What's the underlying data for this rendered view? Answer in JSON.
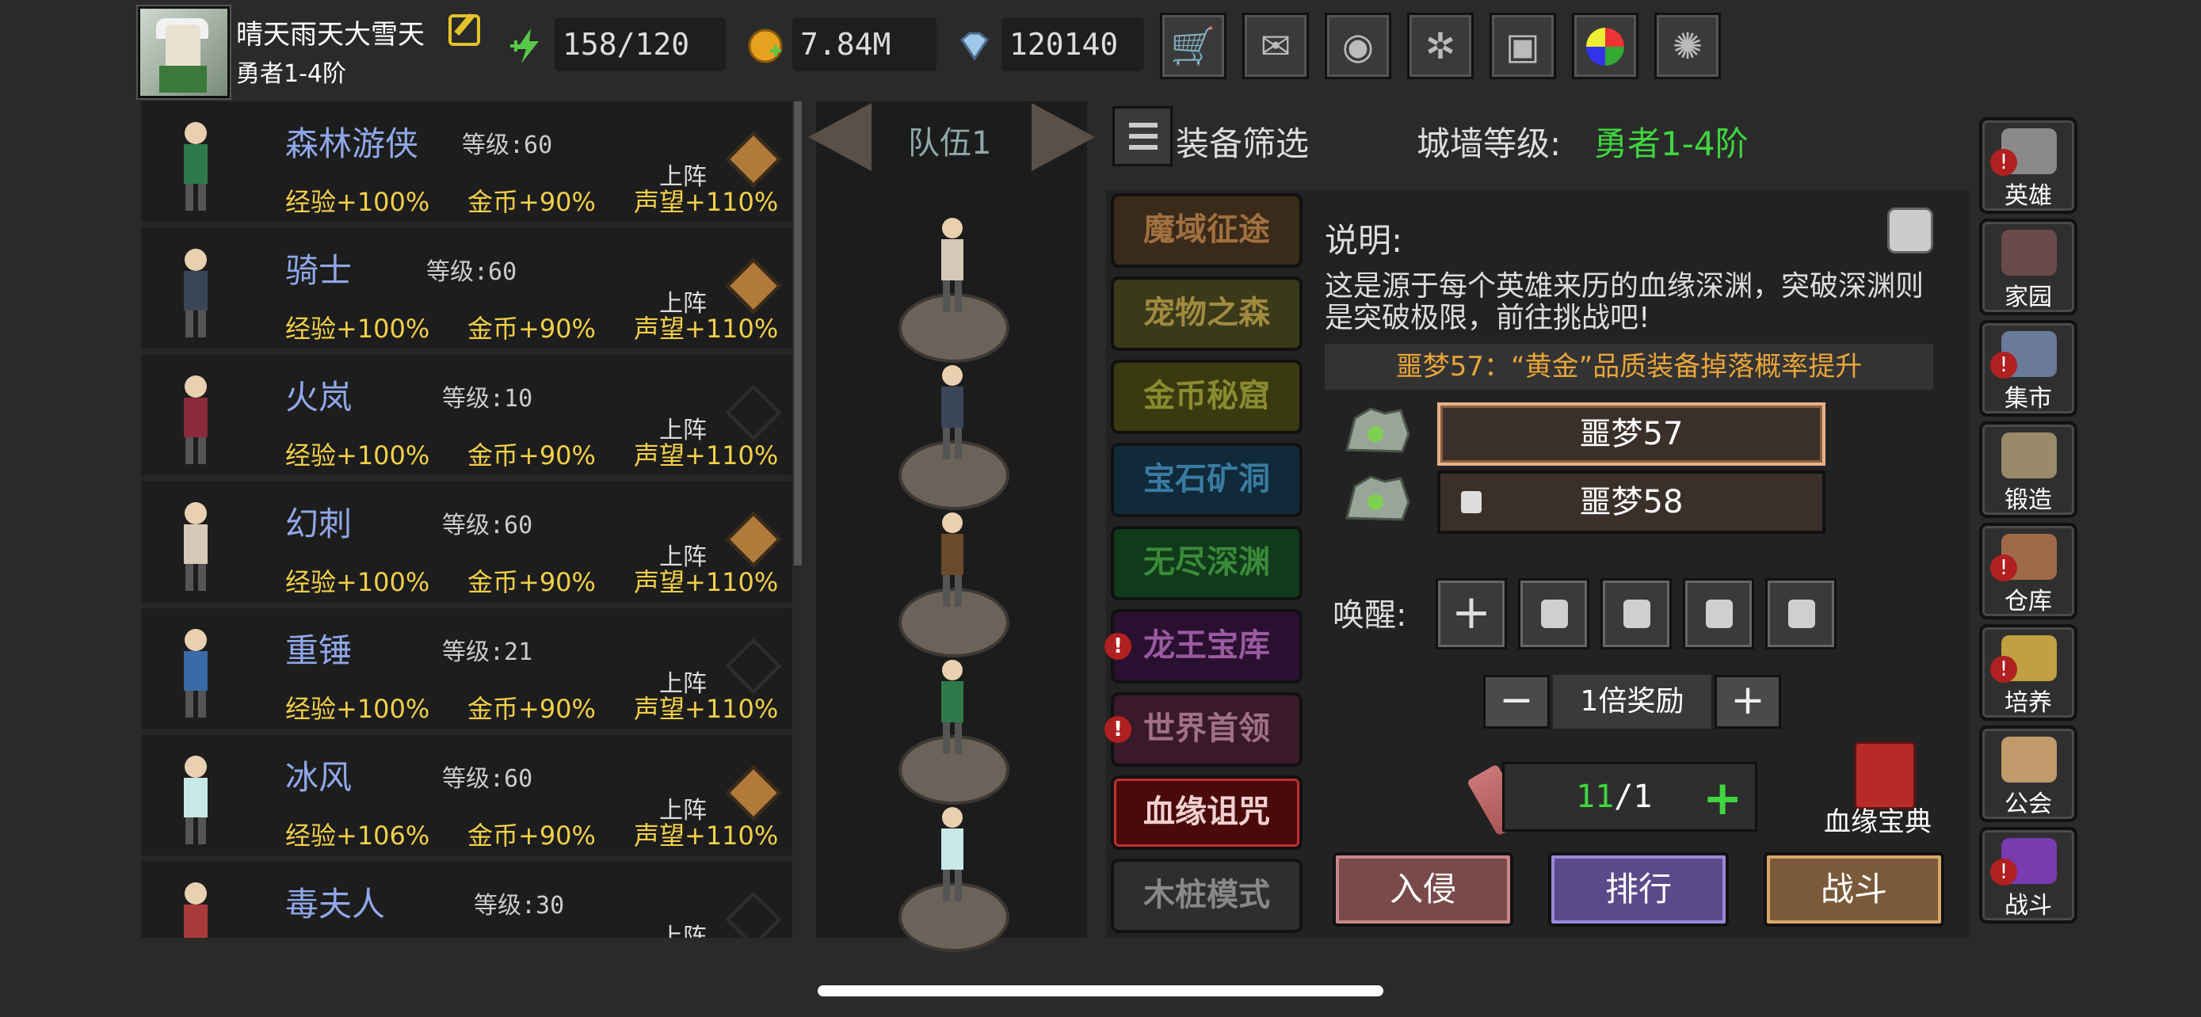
{
  "player": {
    "name": "晴天雨天大雪天",
    "rank": "勇者1-4阶"
  },
  "stats": {
    "energy": "158/120",
    "gold": "7.84M",
    "gems": "120140"
  },
  "top_buttons": [
    "cart-icon",
    "mail-icon",
    "gamepad-icon",
    "gear-icon",
    "gift-icon",
    "color-wheel-icon",
    "firework-icon"
  ],
  "heroes": [
    {
      "name": "森林游侠",
      "level": "等级:60",
      "exp": "经验+100%",
      "gold": "金币+90%",
      "fame": "声望+110%",
      "deploy": "上阵",
      "active": true
    },
    {
      "name": "骑士",
      "level": "等级:60",
      "exp": "经验+100%",
      "gold": "金币+90%",
      "fame": "声望+110%",
      "deploy": "上阵",
      "active": true
    },
    {
      "name": "火岚",
      "level": "等级:10",
      "exp": "经验+100%",
      "gold": "金币+90%",
      "fame": "声望+110%",
      "deploy": "上阵",
      "active": false
    },
    {
      "name": "幻刺",
      "level": "等级:60",
      "exp": "经验+100%",
      "gold": "金币+90%",
      "fame": "声望+110%",
      "deploy": "上阵",
      "active": true
    },
    {
      "name": "重锤",
      "level": "等级:21",
      "exp": "经验+100%",
      "gold": "金币+90%",
      "fame": "声望+110%",
      "deploy": "上阵",
      "active": false
    },
    {
      "name": "冰风",
      "level": "等级:60",
      "exp": "经验+106%",
      "gold": "金币+90%",
      "fame": "声望+110%",
      "deploy": "上阵",
      "active": true
    },
    {
      "name": "毒夫人",
      "level": "等级:30",
      "exp": "",
      "gold": "",
      "fame": "",
      "deploy": "上阵",
      "active": false
    }
  ],
  "team": {
    "label": "队伍1"
  },
  "filter": {
    "label": "装备筛选"
  },
  "wall": {
    "label": "城墙等级:",
    "value": "勇者1-4阶"
  },
  "dungeons": [
    {
      "label": "魔域征途",
      "alert": false
    },
    {
      "label": "宠物之森",
      "alert": false
    },
    {
      "label": "金币秘窟",
      "alert": false
    },
    {
      "label": "宝石矿洞",
      "alert": false
    },
    {
      "label": "无尽深渊",
      "alert": false
    },
    {
      "label": "龙王宝库",
      "alert": true
    },
    {
      "label": "世界首领",
      "alert": true
    },
    {
      "label": "血缘诅咒",
      "alert": false
    },
    {
      "label": "木桩模式",
      "alert": false
    }
  ],
  "description": {
    "heading": "说明:",
    "text": "这是源于每个英雄来历的血缘深渊，突破深渊则是突破极限，前往挑战吧!",
    "notice": "噩梦57：“黄金”品质装备掉落概率提升"
  },
  "levels": [
    {
      "label": "噩梦57",
      "locked": false
    },
    {
      "label": "噩梦58",
      "locked": true
    }
  ],
  "awaken": {
    "label": "唤醒:"
  },
  "reward": {
    "minus": "−",
    "label": "1倍奖励",
    "plus": "+"
  },
  "counter": {
    "current": "11",
    "sep": "/",
    "max": "1",
    "plus": "+"
  },
  "book": {
    "label": "血缘宝典"
  },
  "actions": [
    "入侵",
    "排行",
    "战斗"
  ],
  "nav": [
    {
      "label": "英雄",
      "alert": true,
      "color": "#8a8a8a"
    },
    {
      "label": "家园",
      "alert": false,
      "color": "#6a4a4a"
    },
    {
      "label": "集市",
      "alert": true,
      "color": "#6a7a9a"
    },
    {
      "label": "锻造",
      "alert": false,
      "color": "#9a8a6a"
    },
    {
      "label": "仓库",
      "alert": true,
      "color": "#a06a4a"
    },
    {
      "label": "培养",
      "alert": true,
      "color": "#c0a040"
    },
    {
      "label": "公会",
      "alert": false,
      "color": "#c09a6a"
    },
    {
      "label": "战斗",
      "alert": true,
      "color": "#7a3ab0"
    }
  ]
}
